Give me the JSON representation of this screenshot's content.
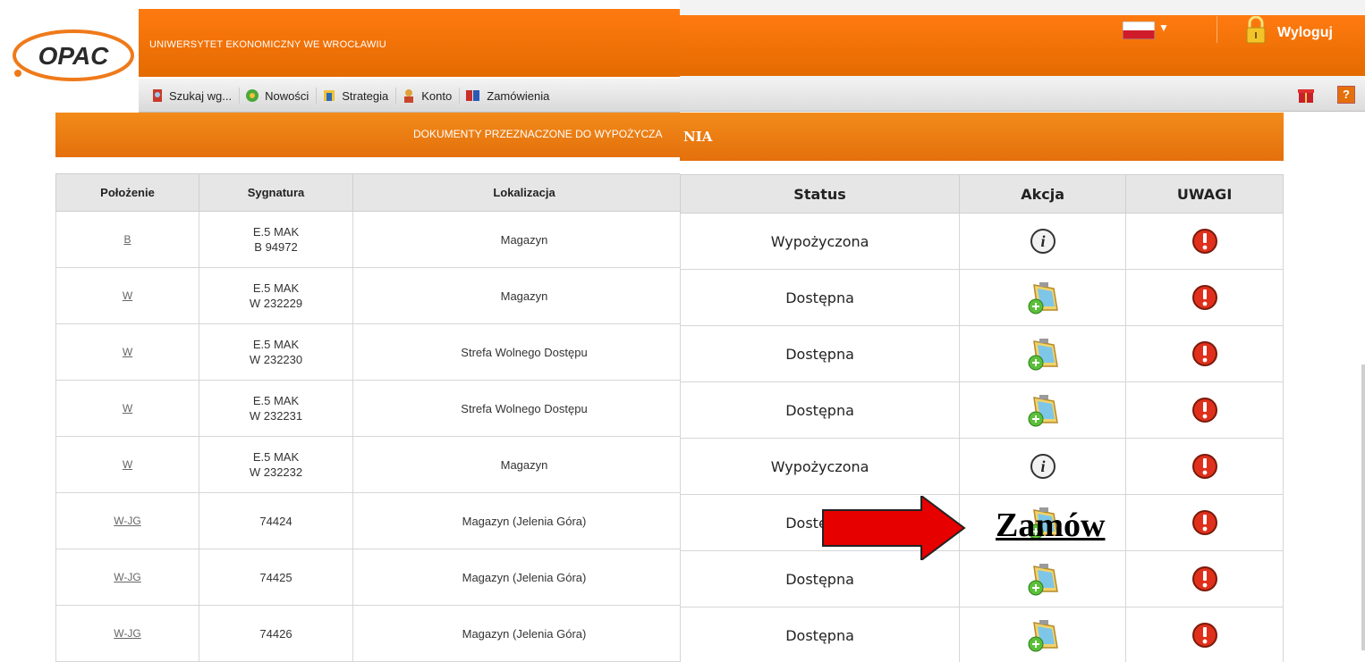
{
  "left": {
    "logo_text": "OPAC",
    "university": "UNIWERSYTET EKONOMICZNY WE WROCŁAWIU",
    "menu": [
      "Szukaj wg...",
      "Nowości",
      "Strategia",
      "Konto",
      "Zamówienia"
    ],
    "band_title": "DOKUMENTY PRZEZNACZONE DO WYPOŻYCZA",
    "headers": [
      "Położenie",
      "Sygnatura",
      "Lokalizacja"
    ],
    "rows": [
      {
        "pol": "B",
        "sig1": "E.5 MAK",
        "sig2": "B 94972",
        "lok": "Magazyn"
      },
      {
        "pol": "W",
        "sig1": "E.5 MAK",
        "sig2": "W 232229",
        "lok": "Magazyn"
      },
      {
        "pol": "W",
        "sig1": "E.5 MAK",
        "sig2": "W 232230",
        "lok": "Strefa Wolnego Dostępu"
      },
      {
        "pol": "W",
        "sig1": "E.5 MAK",
        "sig2": "W 232231",
        "lok": "Strefa Wolnego Dostępu"
      },
      {
        "pol": "W",
        "sig1": "E.5 MAK",
        "sig2": "W 232232",
        "lok": "Magazyn"
      },
      {
        "pol": "W-JG",
        "sig1": "74424",
        "sig2": "",
        "lok": "Magazyn (Jelenia Góra)"
      },
      {
        "pol": "W-JG",
        "sig1": "74425",
        "sig2": "",
        "lok": "Magazyn (Jelenia Góra)"
      },
      {
        "pol": "W-JG",
        "sig1": "74426",
        "sig2": "",
        "lok": "Magazyn (Jelenia Góra)"
      }
    ]
  },
  "right": {
    "logout": "Wyloguj",
    "band_title_tail": "NIA",
    "headers": [
      "Status",
      "Akcja",
      "UWAGI"
    ],
    "rows": [
      {
        "status": "Wypożyczona",
        "akcja": "info-icon"
      },
      {
        "status": "Dostępna",
        "akcja": "order-icon"
      },
      {
        "status": "Dostępna",
        "akcja": "order-icon"
      },
      {
        "status": "Dostępna",
        "akcja": "order-icon"
      },
      {
        "status": "Wypożyczona",
        "akcja": "info-icon"
      },
      {
        "status": "Dostępna",
        "akcja": "order-icon"
      },
      {
        "status": "Dostępna",
        "akcja": "order-icon"
      },
      {
        "status": "Dostępna",
        "akcja": "order-icon"
      }
    ]
  },
  "annotation": {
    "label": "Zamów"
  },
  "colors": {
    "orange": "#e4700c",
    "warn_red": "#e0301c",
    "arrow_red": "#e60000"
  }
}
